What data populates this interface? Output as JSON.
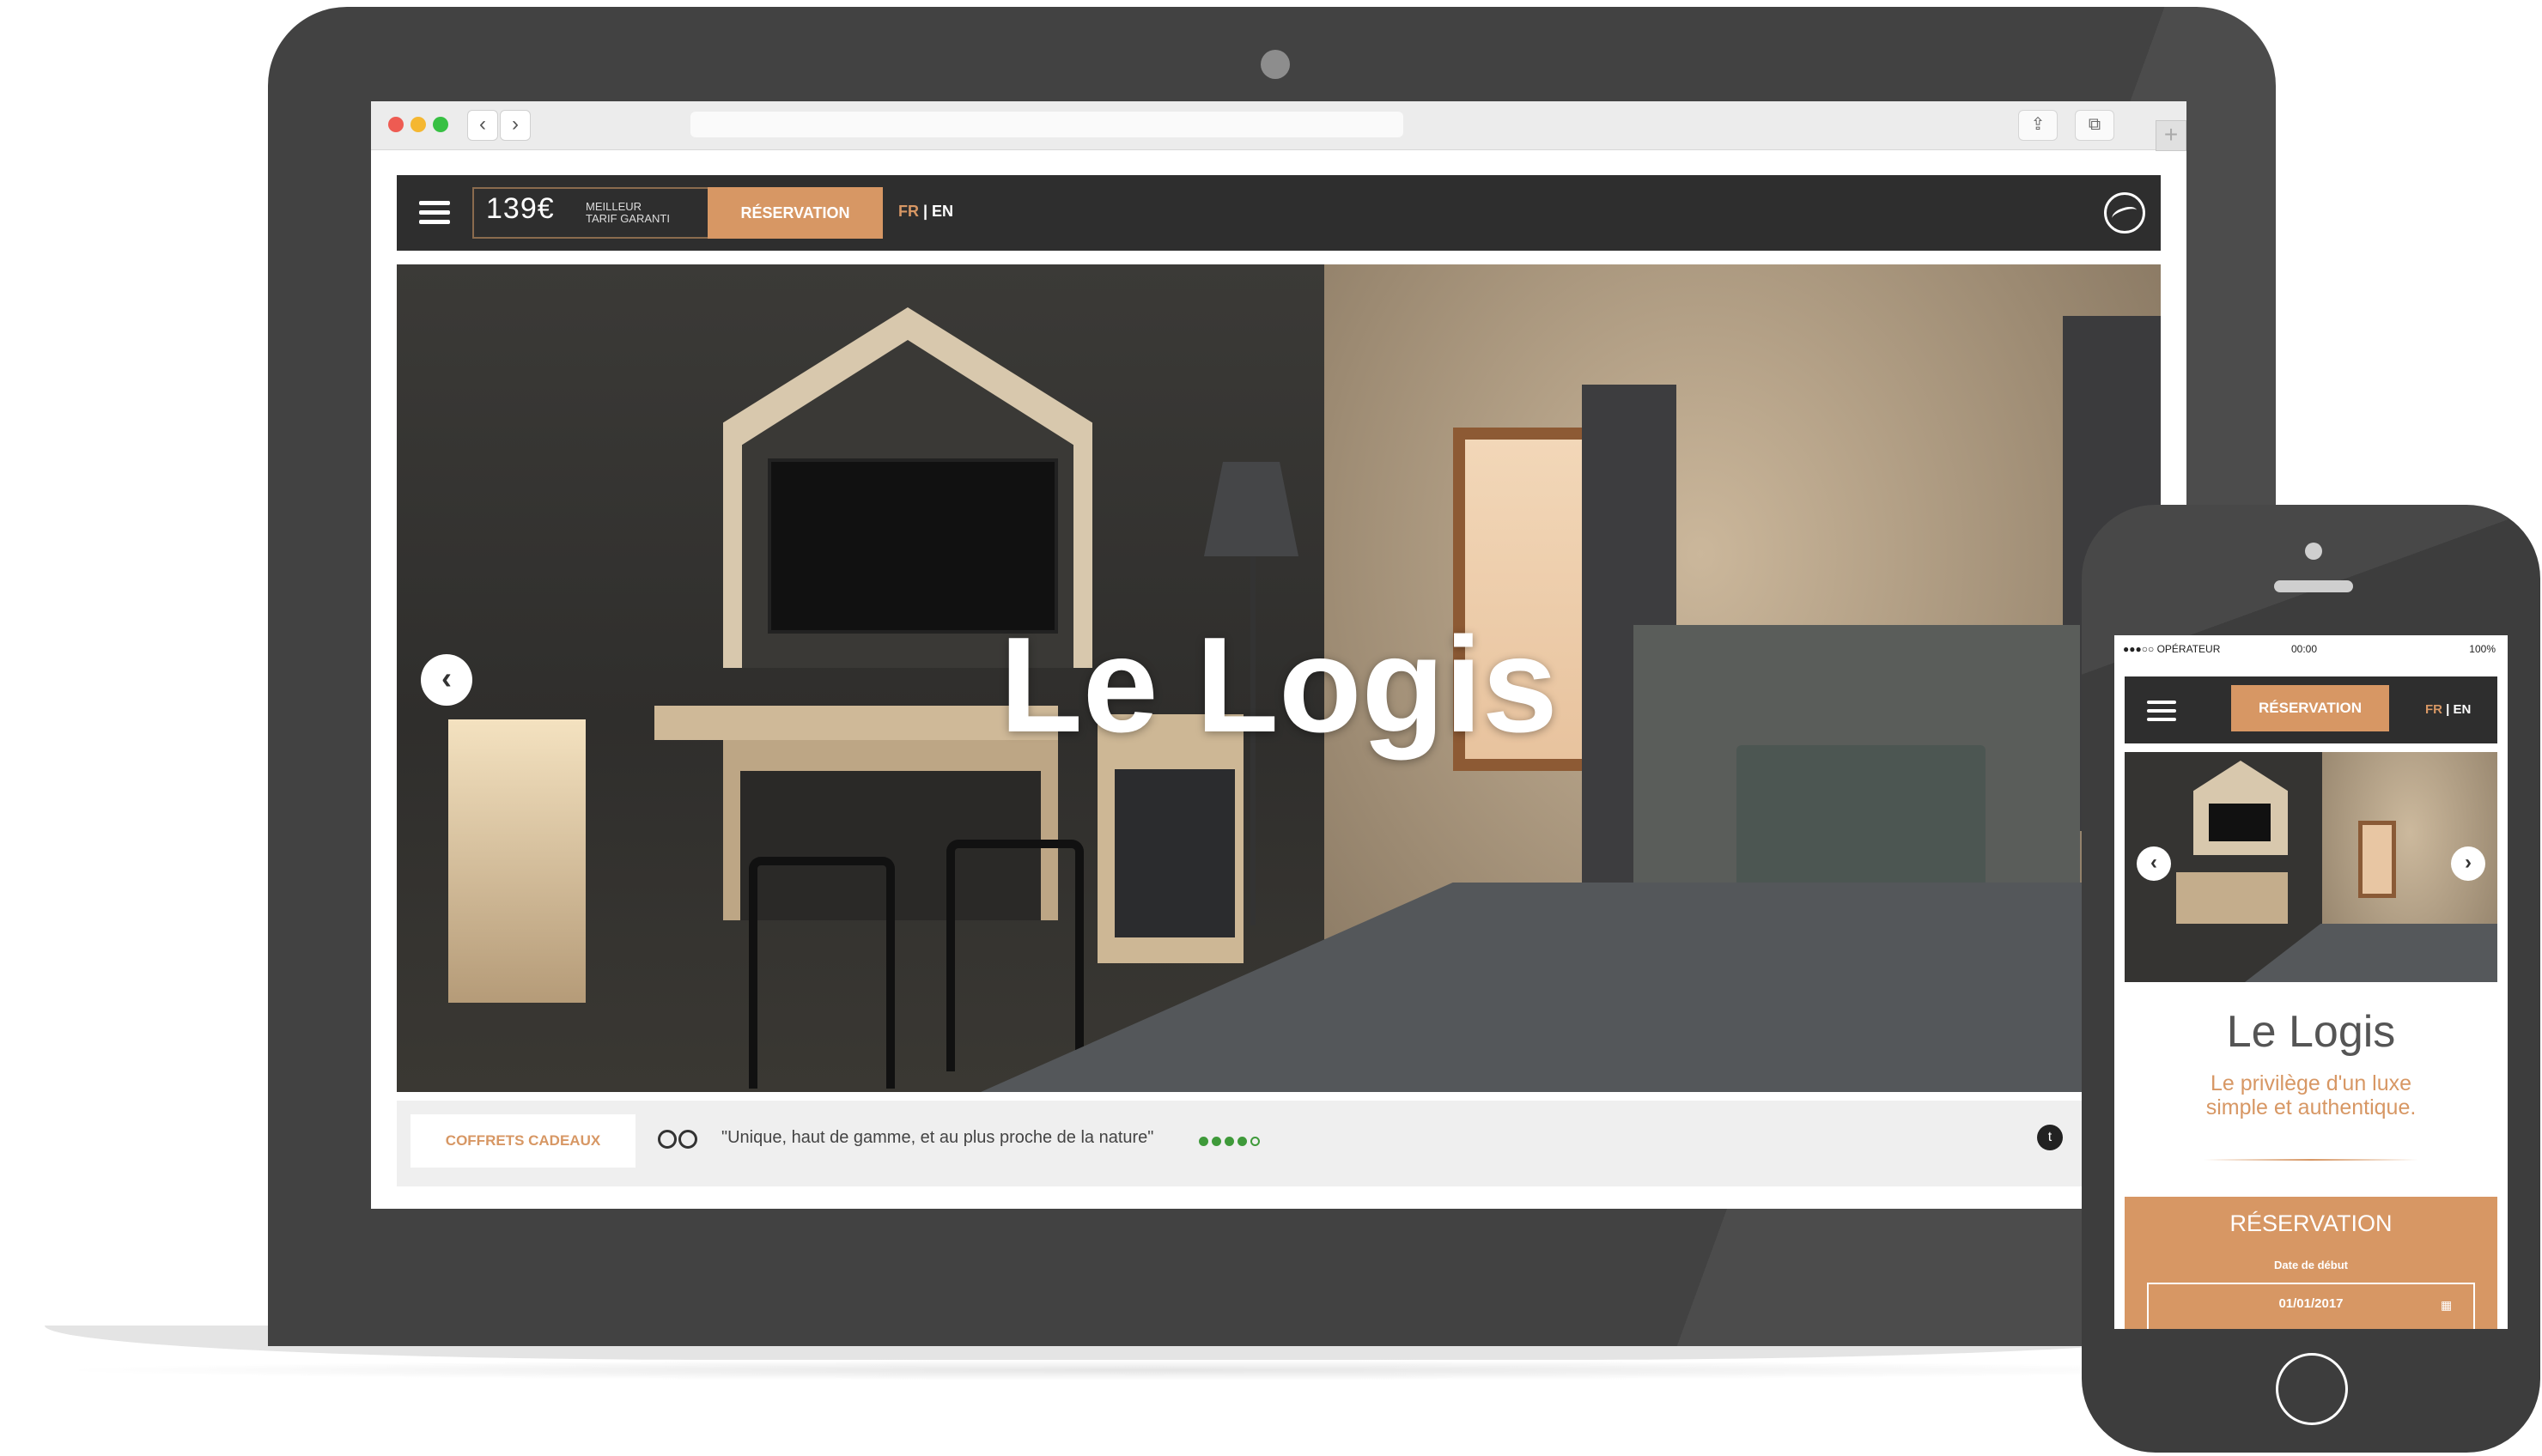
{
  "browser": {
    "back_icon": "‹",
    "forward_icon": "›",
    "share_icon": "⇪",
    "tabs_icon": "⧉",
    "new_tab_icon": "+",
    "traffic_lights": [
      "#ee5b52",
      "#f5b731",
      "#37c043"
    ]
  },
  "site": {
    "price": "139€",
    "price_line1": "MEILLEUR",
    "price_line2": "TARIF GARANTI",
    "reservation_label": "RÉSERVATION",
    "lang_fr": "FR",
    "lang_sep": " | ",
    "lang_en": "EN",
    "hero_title": "Le Logis",
    "prev_arrow": "‹",
    "gift_label": "COFFRETS CADEAUX",
    "review_quote": "\"Unique, haut de gamme, et au plus proche de la nature\"",
    "rating_value": 4,
    "rating_max": 5,
    "twitter_glyph": "t",
    "accent_color": "#d79764"
  },
  "mobile": {
    "operator": "●●●○○ OPÉRATEUR",
    "time": "00:00",
    "battery": "100%",
    "reservation_label": "RÉSERVATION",
    "lang_fr": "FR",
    "lang_sep": " | ",
    "lang_en": "EN",
    "prev_arrow": "‹",
    "next_arrow": "›",
    "title": "Le Logis",
    "subtitle_line1": "Le privilège d'un luxe",
    "subtitle_line2": "simple et authentique.",
    "booking_title": "RÉSERVATION",
    "date_label": "Date de début",
    "date_value": "01/01/2017",
    "calendar_icon": "▦"
  }
}
